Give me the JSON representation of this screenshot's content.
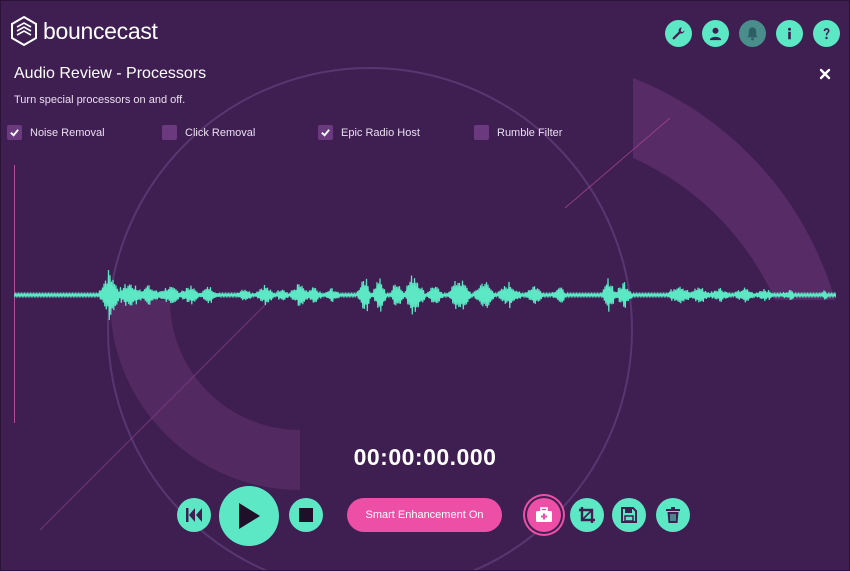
{
  "app": {
    "brand": "bouncecast"
  },
  "header_icons": [
    {
      "name": "wrench-icon"
    },
    {
      "name": "user-icon"
    },
    {
      "name": "bell-icon"
    },
    {
      "name": "info-icon"
    },
    {
      "name": "help-icon"
    }
  ],
  "panel": {
    "title": "Audio Review - Processors",
    "subtitle": "Turn special processors on and off."
  },
  "processors": [
    {
      "label": "Noise Removal",
      "checked": true
    },
    {
      "label": "Click Removal",
      "checked": false
    },
    {
      "label": "Epic Radio Host",
      "checked": true
    },
    {
      "label": "Rumble Filter",
      "checked": false
    }
  ],
  "player": {
    "time": "00:00:00.000"
  },
  "controls": {
    "smart_label": "Smart Enhancement On"
  },
  "colors": {
    "background": "#3f1f52",
    "accent": "#5de8c5",
    "pink": "#ee4fa6"
  }
}
